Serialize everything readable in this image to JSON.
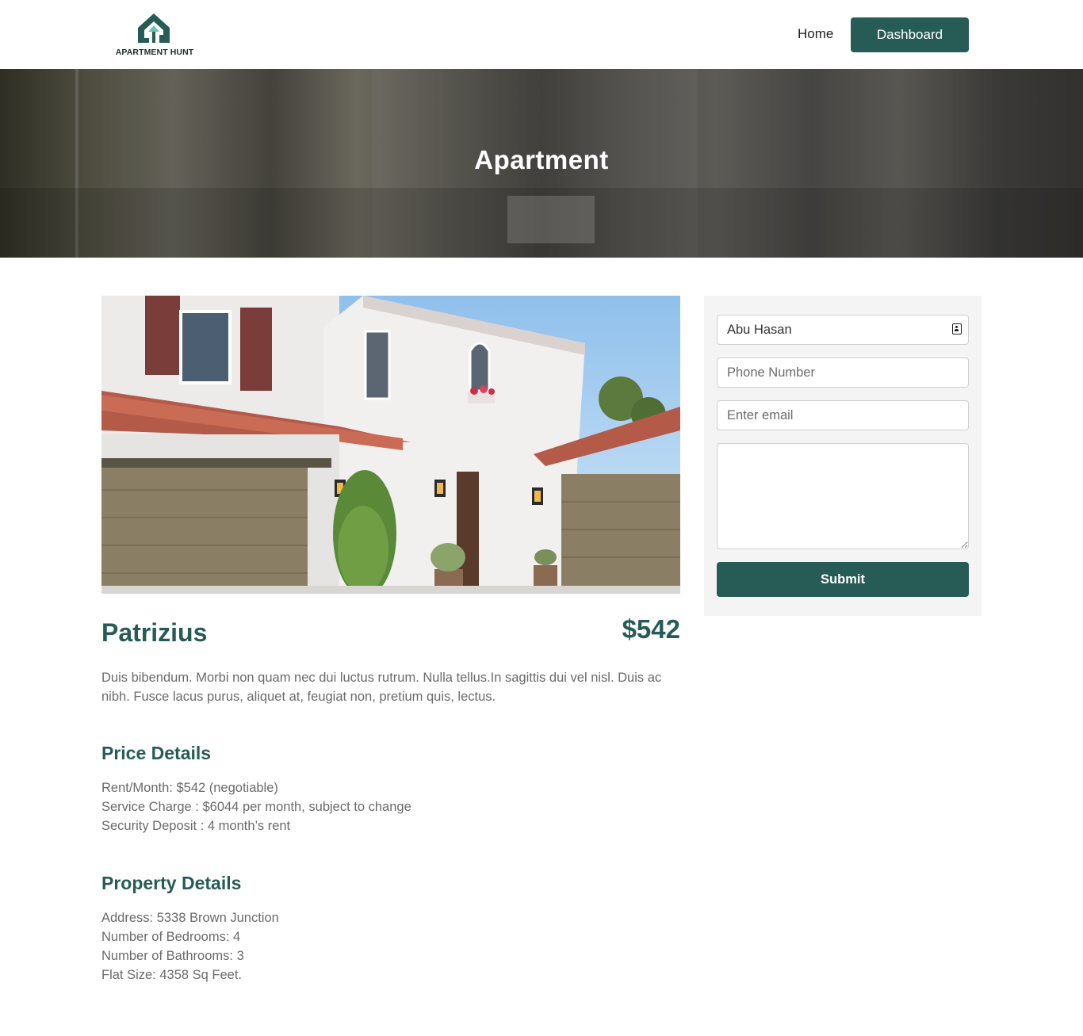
{
  "header": {
    "logo_text": "APARTMENT HUNT",
    "nav_home": "Home",
    "nav_dashboard": "Dashboard"
  },
  "hero": {
    "title": "Apartment"
  },
  "listing": {
    "name": "Patrizius",
    "price": "$542",
    "description": "Duis bibendum. Morbi non quam nec dui luctus rutrum. Nulla tellus.In sagittis dui vel nisl. Duis ac nibh. Fusce lacus purus, aliquet at, feugiat non, pretium quis, lectus."
  },
  "price_details": {
    "title": "Price Details",
    "rent": "Rent/Month: $542 (negotiable)",
    "service_charge": "Service Charge : $6044 per month, subject to change",
    "security_deposit": "Security Deposit : 4 month’s rent"
  },
  "property_details": {
    "title": "Property Details",
    "address": "Address: 5338 Brown Junction",
    "bedrooms": "Number of Bedrooms: 4",
    "bathrooms": "Number of Bathrooms: 3",
    "flat_size": "Flat Size: 4358 Sq Feet."
  },
  "form": {
    "name_value": "Abu Hasan",
    "phone_placeholder": "Phone Number",
    "email_placeholder": "Enter email",
    "submit_label": "Submit"
  },
  "colors": {
    "brand": "#275c56",
    "panel_bg": "#f4f4f4",
    "body_text": "#6b6b6b"
  }
}
